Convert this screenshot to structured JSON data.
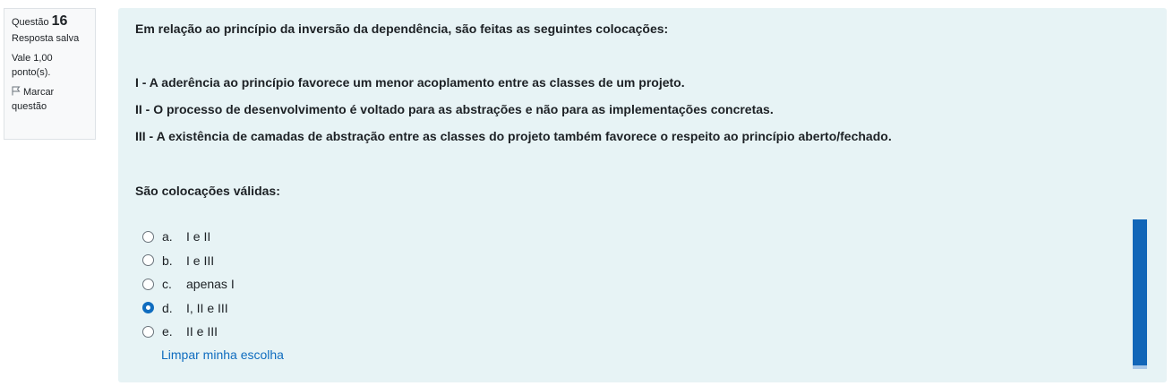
{
  "info": {
    "question_label": "Questão",
    "question_number": "16",
    "state": "Resposta salva",
    "grade_line1": "Vale 1,00",
    "grade_line2": "ponto(s).",
    "flag_line1": "Marcar",
    "flag_line2": "questão",
    "flag_icon": "flag-icon"
  },
  "question": {
    "intro": "Em relação ao princípio da inversão da dependência, são feitas as seguintes colocações:",
    "item1": "I - A aderência ao princípio favorece um menor acoplamento entre as classes de um projeto.",
    "item2": "II - O processo de desenvolvimento é voltado para as abstrações e não para as implementações concretas.",
    "item3": "III - A existência de camadas de abstração entre as classes do projeto também favorece o respeito ao princípio aberto/fechado.",
    "prompt": "São colocações válidas:"
  },
  "answers": {
    "options": [
      {
        "letter": "a.",
        "text": "I e II",
        "selected": false
      },
      {
        "letter": "b.",
        "text": "I e III",
        "selected": false
      },
      {
        "letter": "c.",
        "text": "apenas I",
        "selected": false
      },
      {
        "letter": "d.",
        "text": "I, II e III",
        "selected": true
      },
      {
        "letter": "e.",
        "text": "II e III",
        "selected": false
      }
    ],
    "clear_label": "Limpar minha escolha"
  },
  "colors": {
    "accent": "#0f6cbf",
    "panel_bg": "#e7f3f5",
    "scrollbar": "#1266b8"
  }
}
